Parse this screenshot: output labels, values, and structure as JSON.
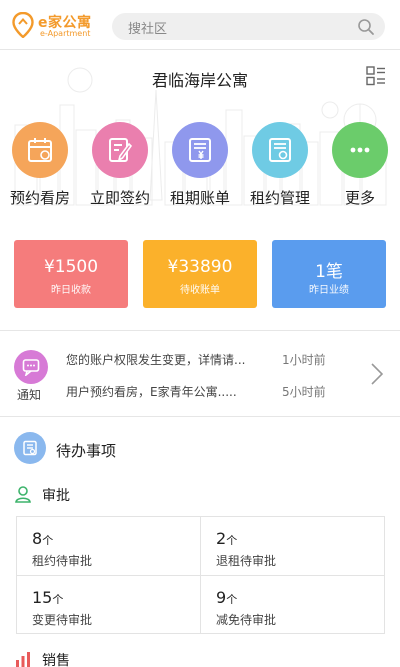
{
  "header": {
    "logo_title": "e家公寓",
    "logo_subtitle": "e-Apartment",
    "brand_color": "#f39a2b",
    "search_placeholder": "搜社区"
  },
  "hero": {
    "title": "君临海岸公寓",
    "menu_icon": "grid-icon"
  },
  "quick_actions": [
    {
      "label": "预约看房",
      "icon": "calendar-icon",
      "color": "#f5a55a"
    },
    {
      "label": "立即签约",
      "icon": "pen-doc-icon",
      "color": "#ea7fae"
    },
    {
      "label": "租期账单",
      "icon": "bill-icon",
      "color": "#8f98ed"
    },
    {
      "label": "租约管理",
      "icon": "contract-icon",
      "color": "#6fcbe4"
    },
    {
      "label": "更多",
      "icon": "more-icon",
      "color": "#6bcc6b"
    }
  ],
  "stats": [
    {
      "value": "¥1500",
      "label": "昨日收款",
      "color": "#f57c7c"
    },
    {
      "value": "¥33890",
      "label": "待收账单",
      "color": "#fbb12b"
    },
    {
      "value": "1笔",
      "label": "昨日业绩",
      "color": "#5a9cee"
    }
  ],
  "notice": {
    "label": "通知",
    "items": [
      {
        "text": "您的账户权限发生变更，详情请...",
        "time": "1小时前"
      },
      {
        "text": "用户预约看房，E家青年公寓.....",
        "time": "5小时前"
      }
    ]
  },
  "todo": {
    "title": "待办事项"
  },
  "approval": {
    "title": "审批",
    "unit": "个",
    "cells": [
      {
        "count": "8",
        "label": "租约待审批"
      },
      {
        "count": "2",
        "label": "退租待审批"
      },
      {
        "count": "15",
        "label": "变更待审批"
      },
      {
        "count": "9",
        "label": "减免待审批"
      }
    ]
  },
  "sales": {
    "title": "销售"
  }
}
